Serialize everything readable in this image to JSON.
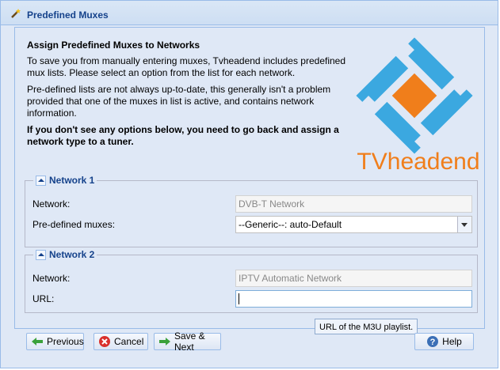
{
  "window": {
    "title": "Predefined Muxes",
    "icon": "wand-icon"
  },
  "intro": {
    "heading": "Assign Predefined Muxes to Networks",
    "p1": "To save you from manually entering muxes, Tvheadend includes predefined mux lists. Please select an option from the list for each network.",
    "p2": "Pre-defined lists are not always up-to-date, this generally isn't a problem provided that one of the muxes in list is active, and contains network information.",
    "p3": "If you don't see any options below, you need to go back and assign a network type to a tuner."
  },
  "logo": {
    "text": "TVheadend",
    "colors": {
      "blue": "#3ba8e0",
      "orange": "#f07e1b"
    }
  },
  "network1": {
    "legend": "Network 1",
    "network_label": "Network:",
    "network_value": "DVB-T Network",
    "muxes_label": "Pre-defined muxes:",
    "muxes_value": "--Generic--: auto-Default"
  },
  "network2": {
    "legend": "Network 2",
    "network_label": "Network:",
    "network_value": "IPTV Automatic Network",
    "url_label": "URL:",
    "url_value": ""
  },
  "tooltip": "URL of the M3U playlist.",
  "buttons": {
    "previous": "Previous",
    "cancel": "Cancel",
    "save_next": "Save & Next",
    "help": "Help"
  }
}
